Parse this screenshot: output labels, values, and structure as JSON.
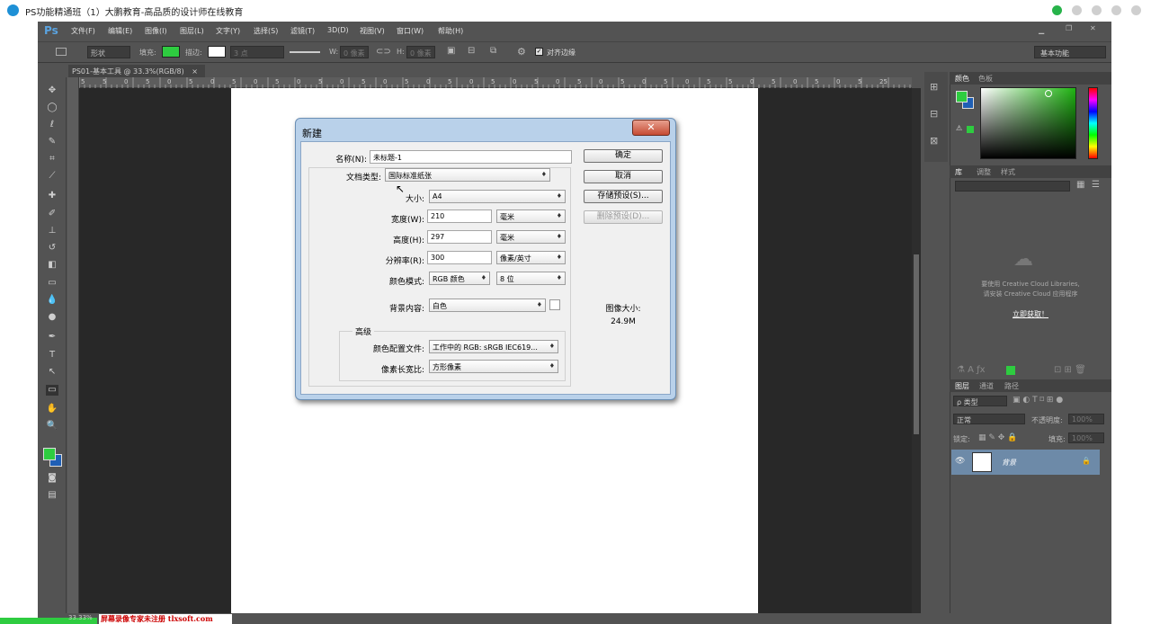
{
  "outer_title": "PS功能精通班（1）大鹏教育-高品质的设计师在线教育",
  "menu": [
    "文件(F)",
    "编辑(E)",
    "图像(I)",
    "图层(L)",
    "文字(Y)",
    "选择(S)",
    "滤镜(T)",
    "3D(D)",
    "视图(V)",
    "窗口(W)",
    "帮助(H)"
  ],
  "ps_logo": "Ps",
  "options": {
    "shape_mode": "形状",
    "fill_label": "填充:",
    "stroke_label": "描边:",
    "stroke_size": "3 点",
    "w_label": "W:",
    "w_value": "0 像素",
    "h_label": "H:",
    "h_value": "0 像素",
    "align_edges": "对齐边缘",
    "workspace": "基本功能"
  },
  "doc_tab": "PS01-基本工具 @ 33.3%(RGB/8)",
  "doc_tab_close": "×",
  "ruler_numbers": [
    "5",
    "5",
    "0",
    "5",
    "0",
    "5",
    "0",
    "5",
    "0",
    "5",
    "0",
    "5",
    "0",
    "5",
    "0",
    "5",
    "0",
    "5",
    "0",
    "5",
    "0",
    "5",
    "0",
    "5",
    "0",
    "5",
    "0",
    "5",
    "0",
    "5",
    "5",
    "0",
    "5",
    "0",
    "5",
    "0",
    "5",
    "25"
  ],
  "panels": {
    "color_tabs": [
      "颜色",
      "色板"
    ],
    "lib_tabs": [
      "库",
      "调整",
      "样式"
    ],
    "cc_line1": "要使用 Creative Cloud Libraries,",
    "cc_line2": "请安装 Creative Cloud 应用程序",
    "cc_link": "立即获取！",
    "layer_tabs": [
      "图层",
      "通道",
      "路径"
    ],
    "kind_filter": "ρ 类型",
    "blend_mode": "正常",
    "opacity_label": "不透明度:",
    "opacity_value": "100%",
    "lock_label": "锁定:",
    "fill_label": "填充:",
    "fill_value": "100%",
    "layer_name": "背景"
  },
  "dialog": {
    "title": "新建",
    "close": "✕",
    "name_label": "名称(N):",
    "name_value": "未标题-1",
    "doctype_label": "文档类型:",
    "doctype_value": "国际标准纸张",
    "size_label": "大小:",
    "size_value": "A4",
    "width_label": "宽度(W):",
    "width_value": "210",
    "width_unit": "毫米",
    "height_label": "高度(H):",
    "height_value": "297",
    "height_unit": "毫米",
    "res_label": "分辨率(R):",
    "res_value": "300",
    "res_unit": "像素/英寸",
    "mode_label": "颜色模式:",
    "mode_value": "RGB 颜色",
    "bits_value": "8 位",
    "bg_label": "背景内容:",
    "bg_value": "白色",
    "advanced": "高级",
    "profile_label": "颜色配置文件:",
    "profile_value": "工作中的 RGB: sRGB IEC619...",
    "aspect_label": "像素长宽比:",
    "aspect_value": "方形像素",
    "ok": "确定",
    "cancel": "取消",
    "save_preset": "存储预设(S)...",
    "delete_preset": "删除预设(D)...",
    "image_size_label": "图像大小:",
    "image_size_value": "24.9M"
  },
  "status": {
    "zoom": "33.33%",
    "watermark": "屏幕录像专家未注册 tlxsoft.com"
  },
  "colors": {
    "fg": "#2ecc40",
    "bg": "#1f5fb5",
    "accent": "#b9d1ea"
  }
}
